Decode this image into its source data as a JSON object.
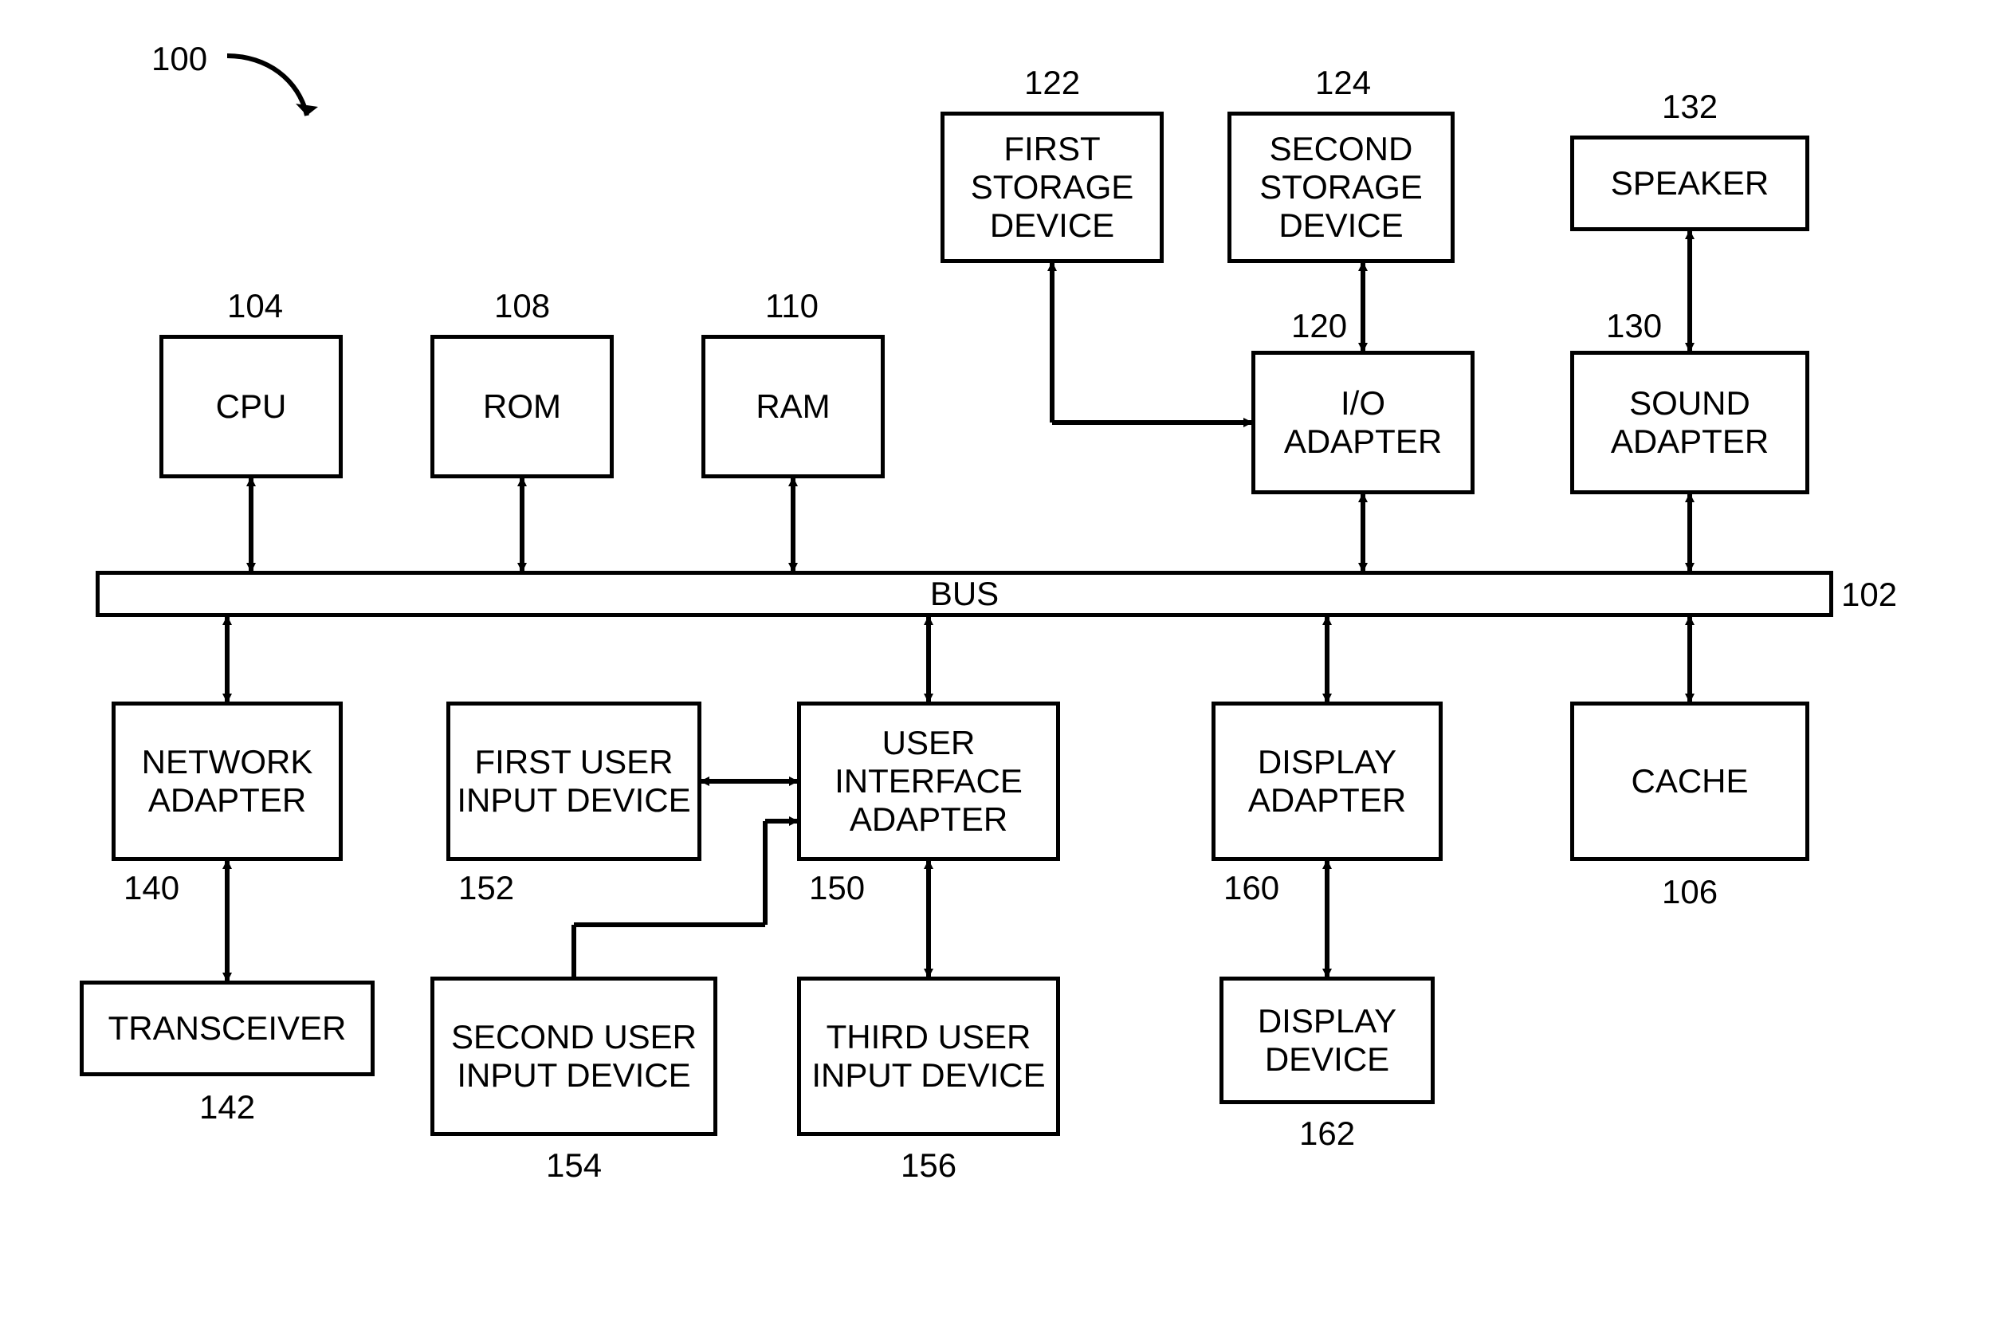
{
  "figure_ref": "100",
  "bus": {
    "label": "BUS",
    "ref": "102"
  },
  "blocks": {
    "cpu": {
      "label": "CPU",
      "ref": "104"
    },
    "rom": {
      "label": "ROM",
      "ref": "108"
    },
    "ram": {
      "label": "RAM",
      "ref": "110"
    },
    "first_storage": {
      "label": "FIRST STORAGE DEVICE",
      "ref": "122"
    },
    "second_storage": {
      "label": "SECOND STORAGE DEVICE",
      "ref": "124"
    },
    "speaker": {
      "label": "SPEAKER",
      "ref": "132"
    },
    "io_adapter": {
      "label": "I/O ADAPTER",
      "ref": "120"
    },
    "sound_adapter": {
      "label": "SOUND ADAPTER",
      "ref": "130"
    },
    "network_adapter": {
      "label": "NETWORK ADAPTER",
      "ref": "140"
    },
    "first_user_input": {
      "label": "FIRST USER INPUT DEVICE",
      "ref": "152"
    },
    "user_interface_adapter": {
      "label": "USER INTERFACE ADAPTER",
      "ref": "150"
    },
    "display_adapter": {
      "label": "DISPLAY ADAPTER",
      "ref": "160"
    },
    "cache": {
      "label": "CACHE",
      "ref": "106"
    },
    "transceiver": {
      "label": "TRANSCEIVER",
      "ref": "142"
    },
    "second_user_input": {
      "label": "SECOND USER INPUT DEVICE",
      "ref": "154"
    },
    "third_user_input": {
      "label": "THIRD USER INPUT DEVICE",
      "ref": "156"
    },
    "display_device": {
      "label": "DISPLAY DEVICE",
      "ref": "162"
    }
  }
}
